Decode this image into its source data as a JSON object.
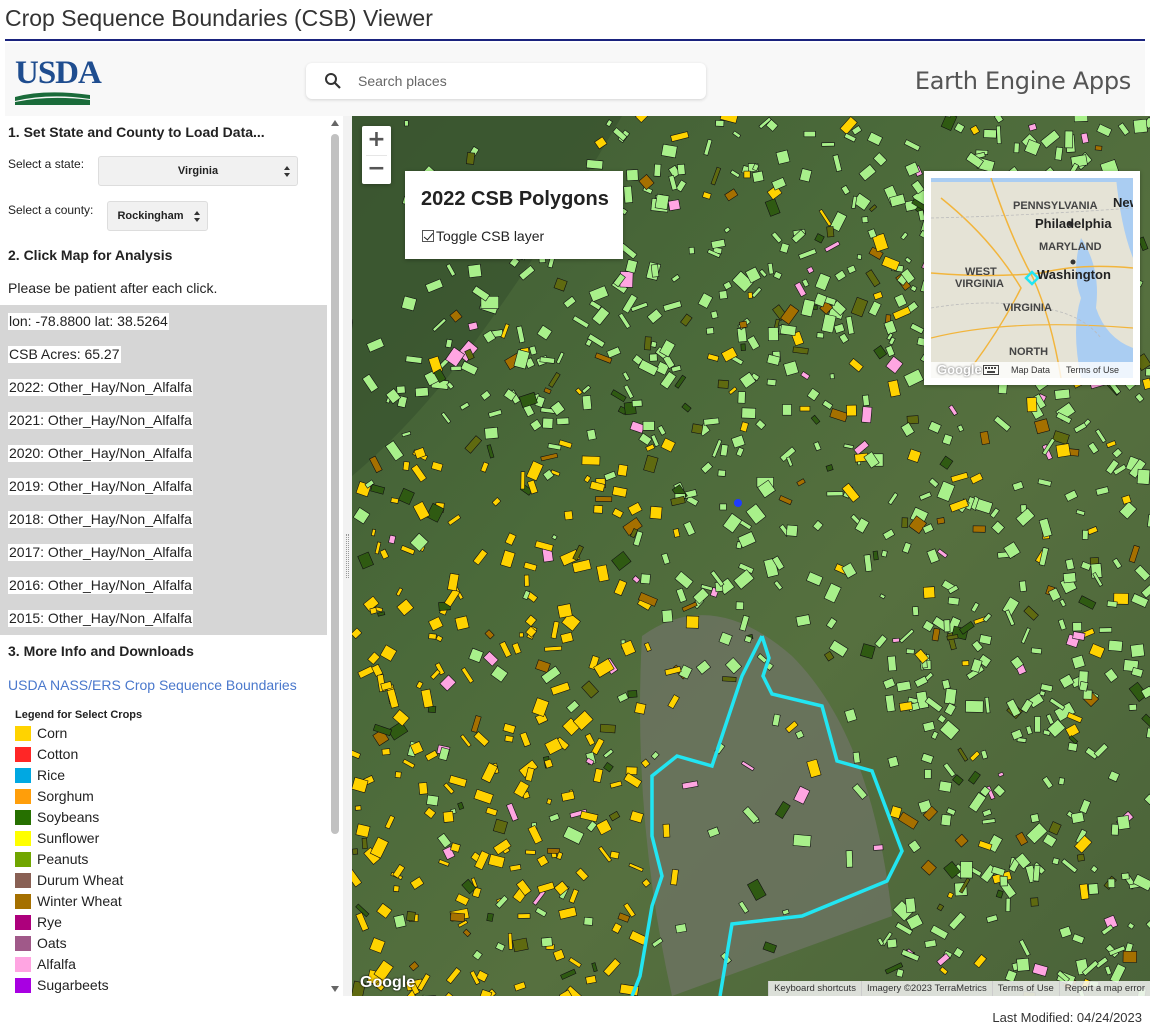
{
  "page": {
    "title": "Crop Sequence Boundaries (CSB) Viewer",
    "last_modified": "Last Modified: 04/24/2023"
  },
  "header": {
    "logo_text": "USDA",
    "search_placeholder": "Search places",
    "brand": "Earth Engine Apps"
  },
  "panel": {
    "section1": "1. Set State and County to Load Data...",
    "state_label": "Select a state:",
    "state_value": "Virginia",
    "county_label": "Select a county:",
    "county_value": "Rockingham",
    "section2": "2. Click Map for Analysis",
    "patience": "Please be patient after each click.",
    "results": [
      "lon: -78.8800 lat: 38.5264",
      "CSB Acres: 65.27",
      "2022: Other_Hay/Non_Alfalfa",
      "2021: Other_Hay/Non_Alfalfa",
      "2020: Other_Hay/Non_Alfalfa",
      "2019: Other_Hay/Non_Alfalfa",
      "2018: Other_Hay/Non_Alfalfa",
      "2017: Other_Hay/Non_Alfalfa",
      "2016: Other_Hay/Non_Alfalfa",
      "2015: Other_Hay/Non_Alfalfa"
    ],
    "section3": "3. More Info and Downloads",
    "link": "USDA NASS/ERS Crop Sequence Boundaries",
    "legend_title": "Legend for Select Crops",
    "legend": [
      {
        "label": "Corn",
        "color": "#ffd300"
      },
      {
        "label": "Cotton",
        "color": "#ff2626"
      },
      {
        "label": "Rice",
        "color": "#00a8e2"
      },
      {
        "label": "Sorghum",
        "color": "#ff9e0a"
      },
      {
        "label": "Soybeans",
        "color": "#267000"
      },
      {
        "label": "Sunflower",
        "color": "#ffff00"
      },
      {
        "label": "Peanuts",
        "color": "#70a500"
      },
      {
        "label": "Durum Wheat",
        "color": "#896054"
      },
      {
        "label": "Winter Wheat",
        "color": "#a57000"
      },
      {
        "label": "Rye",
        "color": "#ad007c"
      },
      {
        "label": "Oats",
        "color": "#a05989"
      },
      {
        "label": "Alfalfa",
        "color": "#ffa5e2"
      },
      {
        "label": "Sugarbeets",
        "color": "#a800e2"
      }
    ]
  },
  "map": {
    "zoom_in": "+",
    "zoom_out": "−",
    "layer_title": "2022 CSB Polygons",
    "layer_toggle": "Toggle CSB layer",
    "google": "Google",
    "attribution": [
      "Keyboard shortcuts",
      "Imagery ©2023 TerraMetrics",
      "Terms of Use",
      "Report a map error"
    ],
    "minimap": {
      "labels": [
        "PENNSYLVANIA",
        "Philadelphia",
        "MARYLAND",
        "Washington",
        "WEST",
        "VIRGINIA",
        "VIRGINIA",
        "NORTH",
        "New"
      ],
      "google": "Google",
      "footer": [
        "Map Data",
        "Terms of Use"
      ]
    }
  }
}
